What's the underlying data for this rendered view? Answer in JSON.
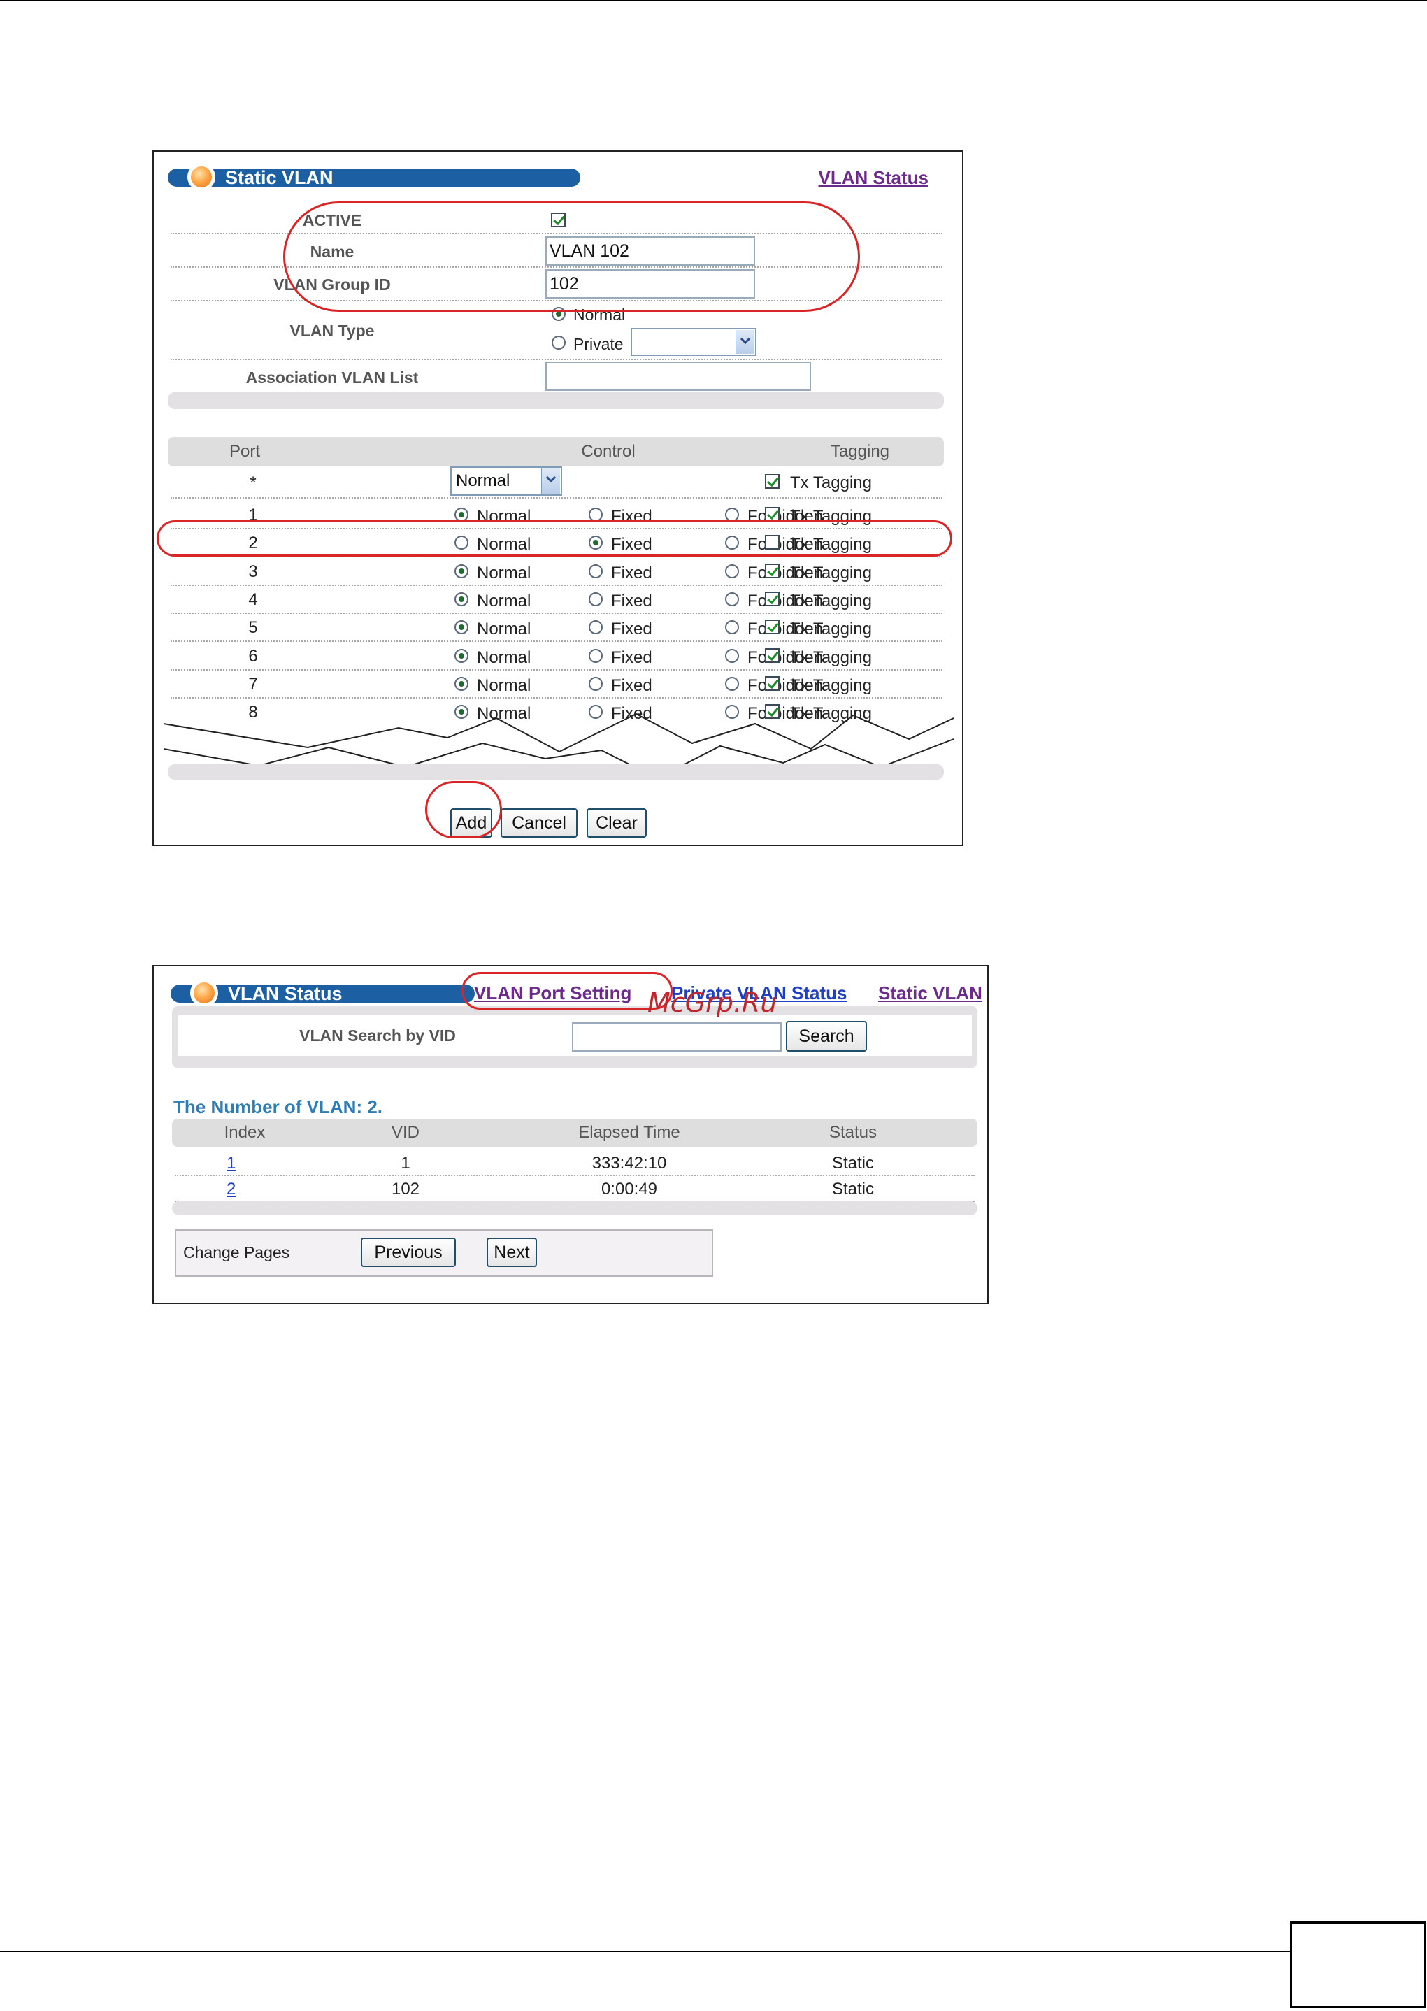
{
  "static_vlan": {
    "title": "Static VLAN",
    "status_link": "VLAN Status",
    "fields": {
      "active_label": "ACTIVE",
      "active_checked": true,
      "name_label": "Name",
      "name_value": "VLAN 102",
      "group_id_label": "VLAN Group ID",
      "group_id_value": "102",
      "type_label": "VLAN Type",
      "type_options": [
        "Normal",
        "Private"
      ],
      "type_selected": "Normal",
      "private_select_value": "",
      "assoc_label": "Association VLAN List",
      "assoc_value": ""
    },
    "ports_table": {
      "headers": [
        "Port",
        "Control",
        "Tagging"
      ],
      "all_row": {
        "port": "*",
        "control_select": "Normal",
        "tagging_label": "Tx Tagging",
        "tagged": true
      },
      "rows": [
        {
          "port": "1",
          "control": "Normal",
          "tagged": true
        },
        {
          "port": "2",
          "control": "Fixed",
          "tagged": false
        },
        {
          "port": "3",
          "control": "Normal",
          "tagged": true
        },
        {
          "port": "4",
          "control": "Normal",
          "tagged": true
        },
        {
          "port": "5",
          "control": "Normal",
          "tagged": true
        },
        {
          "port": "6",
          "control": "Normal",
          "tagged": true
        },
        {
          "port": "7",
          "control": "Normal",
          "tagged": true
        },
        {
          "port": "8",
          "control": "Normal",
          "tagged": true
        }
      ],
      "control_options": [
        "Normal",
        "Fixed",
        "Forbidden"
      ],
      "tagging_label": "Tx Tagging"
    },
    "buttons": {
      "add": "Add",
      "cancel": "Cancel",
      "clear": "Clear"
    }
  },
  "vlan_status": {
    "title": "VLAN Status",
    "links": {
      "port_setting": "VLAN Port Setting",
      "private_status": "Private VLAN Status",
      "static_vlan": "Static VLAN"
    },
    "search_label": "VLAN Search by VID",
    "search_value": "",
    "search_button": "Search",
    "count_text": "The Number of VLAN: 2.",
    "table": {
      "headers": [
        "Index",
        "VID",
        "Elapsed Time",
        "Status"
      ],
      "rows": [
        {
          "index": "1",
          "vid": "1",
          "elapsed": "333:42:10",
          "status": "Static"
        },
        {
          "index": "2",
          "vid": "102",
          "elapsed": "0:00:49",
          "status": "Static"
        }
      ]
    },
    "change_pages_label": "Change Pages",
    "previous_button": "Previous",
    "next_button": "Next"
  },
  "watermark": "McGrp.Ru",
  "colors": {
    "title_bar": "#1d5fa3",
    "link": "#6b2a8c",
    "link_blue": "#1f3fc4",
    "callout": "#d92525",
    "section_text": "#2e7db5"
  }
}
